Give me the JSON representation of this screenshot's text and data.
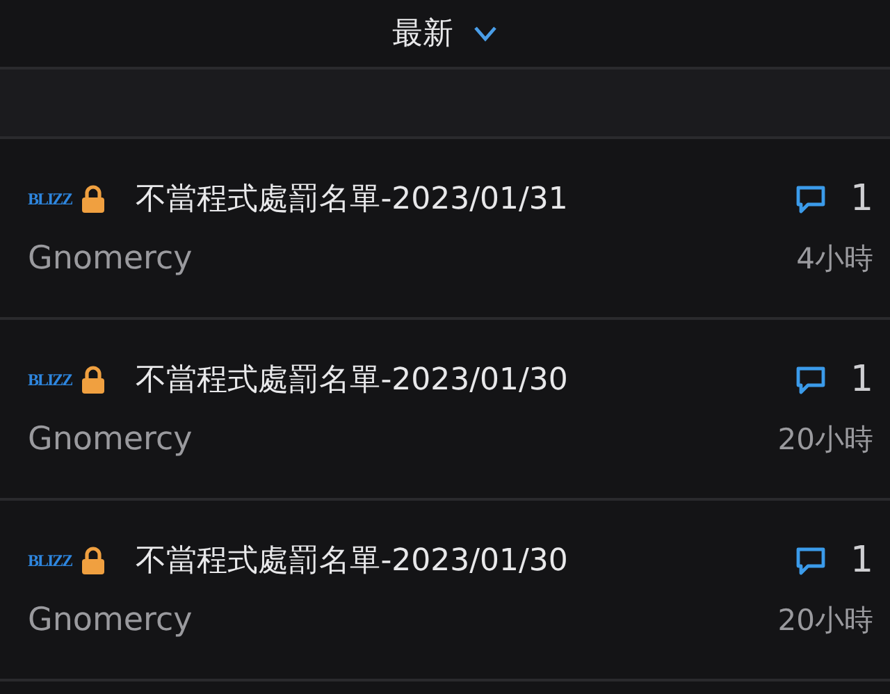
{
  "sort": {
    "label": "最新"
  },
  "topics": [
    {
      "badge": "BLIZZ",
      "locked": true,
      "title": "不當程式處罰名單-2023/01/31",
      "author": "Gnomercy",
      "replies": "1",
      "time": "4小時"
    },
    {
      "badge": "BLIZZ",
      "locked": true,
      "title": "不當程式處罰名單-2023/01/30",
      "author": "Gnomercy",
      "replies": "1",
      "time": "20小時"
    },
    {
      "badge": "BLIZZ",
      "locked": true,
      "title": "不當程式處罰名單-2023/01/30",
      "author": "Gnomercy",
      "replies": "1",
      "time": "20小時"
    }
  ]
}
